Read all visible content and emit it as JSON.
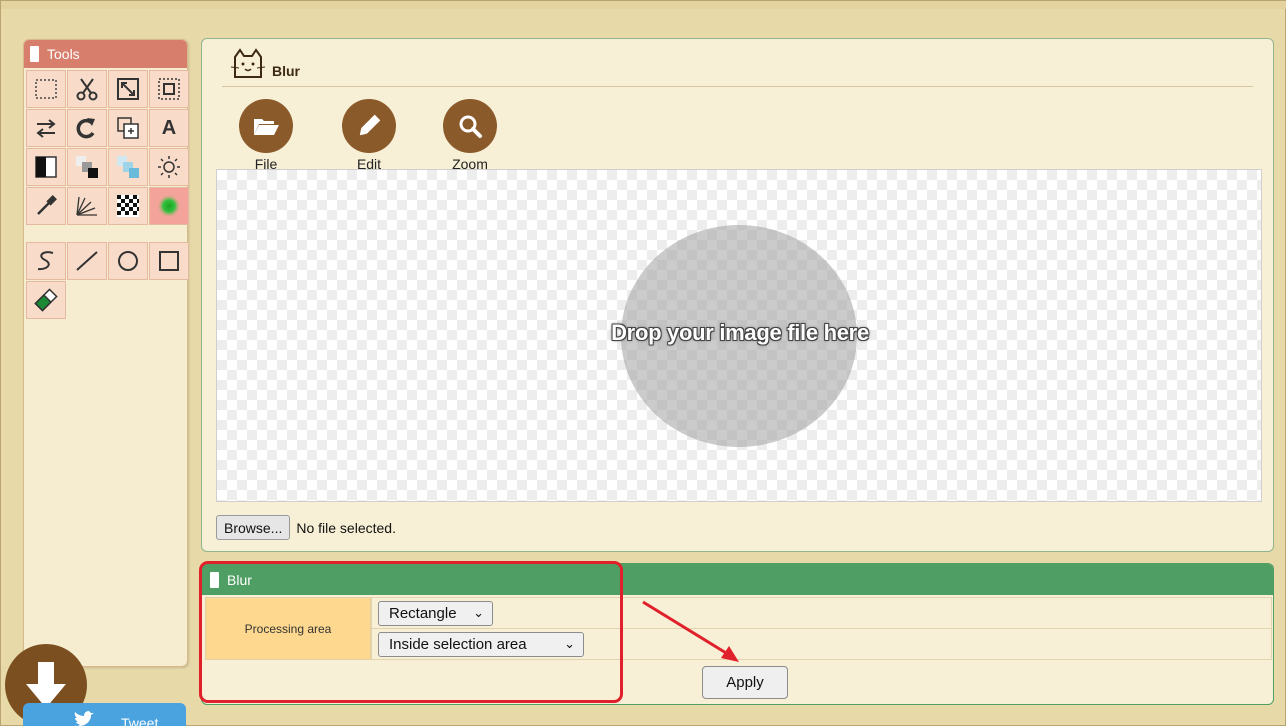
{
  "tools_panel": {
    "title": "Tools",
    "tools": [
      {
        "name": "select-rect-icon",
        "active": false
      },
      {
        "name": "scissors-icon",
        "active": false
      },
      {
        "name": "resize-icon",
        "active": false
      },
      {
        "name": "crop-icon",
        "active": false
      },
      {
        "name": "flip-icon",
        "active": false
      },
      {
        "name": "rotate-icon",
        "active": false
      },
      {
        "name": "copy-layer-icon",
        "active": false
      },
      {
        "name": "text-icon",
        "active": false
      },
      {
        "name": "contrast-icon",
        "active": false
      },
      {
        "name": "grayscale-icon",
        "active": false
      },
      {
        "name": "color-icon",
        "active": false
      },
      {
        "name": "brightness-icon",
        "active": false
      },
      {
        "name": "eyedropper-icon",
        "active": false
      },
      {
        "name": "sparkle-icon",
        "active": false
      },
      {
        "name": "mosaic-icon",
        "active": false
      },
      {
        "name": "blur-icon",
        "active": true
      },
      {
        "name": "curve-icon",
        "active": false
      },
      {
        "name": "line-icon",
        "active": false
      },
      {
        "name": "circle-icon",
        "active": false
      },
      {
        "name": "square-icon",
        "active": false
      },
      {
        "name": "eraser-icon",
        "active": false
      }
    ],
    "text_tool_glyph": "A"
  },
  "main": {
    "title": "Blur",
    "toolbar": {
      "file_label": "File",
      "edit_label": "Edit",
      "zoom_label": "Zoom"
    },
    "canvas": {
      "drop_text": "Drop your image file here"
    },
    "file_input": {
      "browse_label": "Browse...",
      "status": "No file selected."
    }
  },
  "blur_panel": {
    "title": "Blur",
    "processing_area_label": "Processing area",
    "shape_select": "Rectangle",
    "area_select": "Inside selection area",
    "apply_label": "Apply"
  },
  "social": {
    "tweet_label": "Tweet"
  },
  "colors": {
    "tools_header": "#d77f6c",
    "blur_header": "#4f9e63",
    "accent_brown": "#8b5a2b",
    "annotation_red": "#e0202a"
  }
}
